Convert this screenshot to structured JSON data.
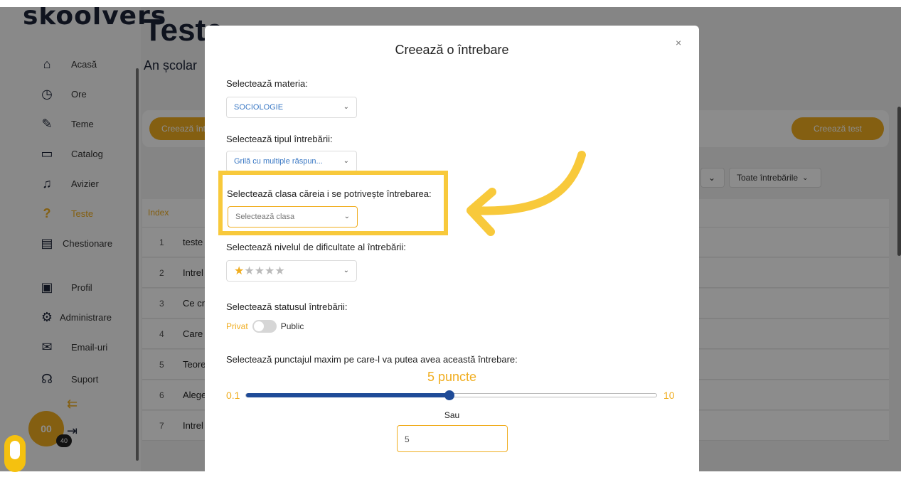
{
  "app": {
    "logo_text": "skoolvers",
    "page_title": "Teste",
    "page_subtitle": "An școlar",
    "sidebar": {
      "items": [
        {
          "label": "Acasă",
          "icon": "home-icon"
        },
        {
          "label": "Ore",
          "icon": "clock-icon"
        },
        {
          "label": "Teme",
          "icon": "pencil-icon"
        },
        {
          "label": "Catalog",
          "icon": "book-icon"
        },
        {
          "label": "Avizier",
          "icon": "bell-icon"
        },
        {
          "label": "Teste",
          "icon": "question-icon",
          "active": true
        },
        {
          "label": "Chestionare",
          "icon": "document-icon"
        },
        {
          "label": "Profil",
          "icon": "profile-icon"
        },
        {
          "label": "Administrare",
          "icon": "gears-icon"
        },
        {
          "label": "Email-uri",
          "icon": "mail-icon"
        },
        {
          "label": "Suport",
          "icon": "headset-icon"
        }
      ],
      "avatar_text": "00",
      "badge_count": "40"
    },
    "toolbar": {
      "create_question_label": "Creează înt",
      "create_test_label": "Creează test",
      "filter_all_label": "Toate întrebările"
    },
    "table": {
      "index_header": "Index",
      "rows": [
        {
          "index": "1",
          "text": "teste"
        },
        {
          "index": "2",
          "text": "Intrel"
        },
        {
          "index": "3",
          "text": "Ce cr"
        },
        {
          "index": "4",
          "text": "Care"
        },
        {
          "index": "5",
          "text": "Teore"
        },
        {
          "index": "6",
          "text": "Alege"
        },
        {
          "index": "7",
          "text": "Intrel"
        }
      ]
    }
  },
  "modal": {
    "title": "Creează o întrebare",
    "close_label": "×",
    "subject_label": "Selectează materia:",
    "subject_value": "SOCIOLOGIE",
    "type_label": "Selectează tipul întrebării:",
    "type_value": "Grilă cu multiple răspun...",
    "class_label": "Selectează clasa căreia i se potrivește întrebarea:",
    "class_placeholder": "Selectează clasa",
    "difficulty_label": "Selectează nivelul de dificultate al întrebării:",
    "difficulty_rating": 1,
    "difficulty_max": 5,
    "status_label": "Selectează statusul întrebării:",
    "status_private": "Privat",
    "status_public": "Public",
    "points_label": "Selectează punctajul maxim pe care-l va putea avea această întrebare:",
    "points_display": "5 puncte",
    "slider_min": "0.1",
    "slider_max": "10",
    "slider_value": 5,
    "or_label": "Sau",
    "points_input_value": "5"
  },
  "colors": {
    "accent": "#f0ad1f",
    "highlight": "#f8c93b",
    "slider": "#1f4b98",
    "link_blue": "#3a78c4"
  }
}
